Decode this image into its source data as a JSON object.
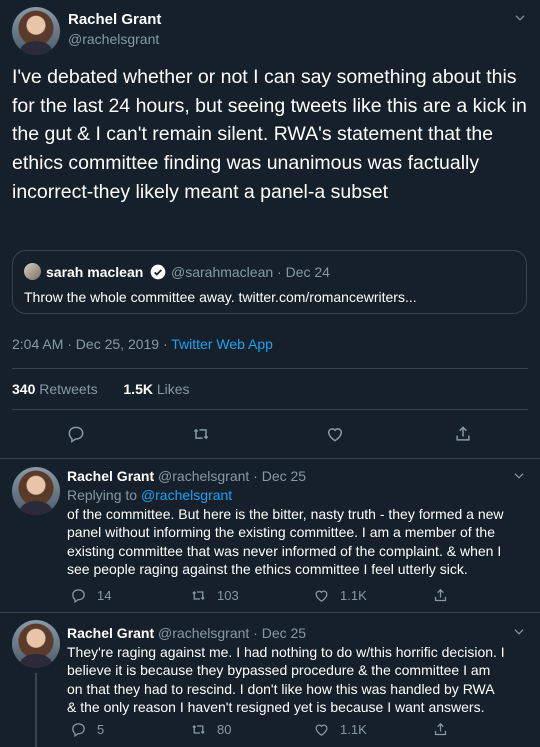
{
  "main": {
    "name": "Rachel Grant",
    "handle": "@rachelsgrant",
    "text": "I've debated whether or not I can say something about this for the last 24 hours, but seeing tweets like this are a kick in the gut & I can't remain silent. RWA's statement that the ethics committee finding was unanimous was factually incorrect-they likely meant a panel-a subset",
    "quote": {
      "name": "sarah maclean",
      "handle": "@sarahmaclean",
      "date": "Dec 24",
      "meta": "@sarahmaclean · Dec 24",
      "text": "Throw the whole committee away. twitter.com/romancewriters..."
    },
    "timestamp": "2:04 AM · Dec 25, 2019 · ",
    "app": "Twitter Web App",
    "retweets_count": "340",
    "retweets_label": "Retweets",
    "likes_count": "1.5K",
    "likes_label": "Likes"
  },
  "replies": [
    {
      "name": "Rachel Grant",
      "meta": "@rachelsgrant · Dec 25",
      "replying_prefix": "Replying to ",
      "replying_to": "@rachelsgrant",
      "text": "of the committee. But here is the bitter, nasty truth - they formed a new panel without informing the existing committee. I am a member of the existing committee that was never informed of the complaint. & when I see people raging against the ethics committee I feel utterly sick.",
      "reply_count": "14",
      "retweet_count": "103",
      "like_count": "1.1K"
    },
    {
      "name": "Rachel Grant",
      "meta": "@rachelsgrant · Dec 25",
      "text": "They're raging against me. I had nothing to do w/this horrific decision. I believe it is because they bypassed procedure & the committee I am on that they had to rescind. I don't like how this was handled by RWA & the only reason I haven't resigned yet is because I want answers.",
      "reply_count": "5",
      "retweet_count": "80",
      "like_count": "1.1K"
    }
  ],
  "colors": {
    "background": "#15202b",
    "border": "#38444d",
    "secondary_text": "#8899a6",
    "accent": "#1da1f2"
  },
  "icons": [
    "chevron-down-icon",
    "reply-icon",
    "retweet-icon",
    "like-icon",
    "share-icon",
    "verified-badge-icon"
  ]
}
